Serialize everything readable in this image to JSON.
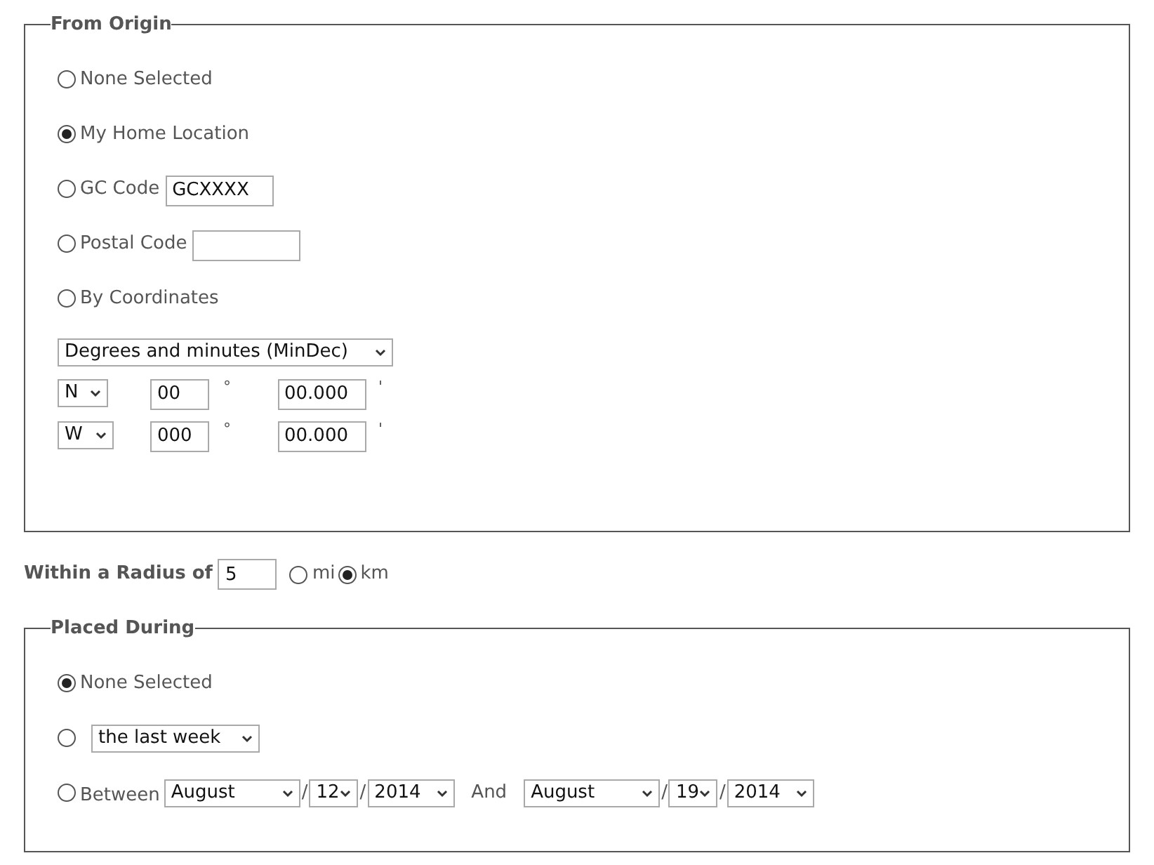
{
  "origin": {
    "legend": "From Origin",
    "options": [
      {
        "kind": "plain",
        "label": "None Selected",
        "selected": false
      },
      {
        "kind": "plain",
        "label": "My Home Location",
        "selected": true
      },
      {
        "kind": "field",
        "label": "GC Code",
        "value": "GCXXXX",
        "selected": false
      },
      {
        "kind": "field",
        "label": "Postal Code",
        "selected": false
      },
      {
        "kind": "plain",
        "label": "By Coordinates",
        "selected": false
      }
    ],
    "format": "Degrees and minutes (MinDec)",
    "coords": [
      {
        "hemisphere": "N",
        "degrees": "00",
        "degree_mark": "°",
        "minutes": "00.000",
        "minute_mark": "'"
      },
      {
        "hemisphere": "W",
        "degrees": "000",
        "degree_mark": "°",
        "minutes": "00.000",
        "minute_mark": "'"
      }
    ]
  },
  "radius": {
    "label": "Within a Radius of",
    "value": "5",
    "units": [
      {
        "label": "mi",
        "selected": false
      },
      {
        "label": "km",
        "selected": true
      }
    ]
  },
  "placed": {
    "legend": "Placed During",
    "options": [
      {
        "kind": "plain",
        "label": "None Selected",
        "selected": true
      },
      {
        "kind": "period",
        "value": "the last week",
        "selected": false
      },
      {
        "kind": "range",
        "label": "Between",
        "from": [
          "August",
          "12",
          "2014"
        ],
        "separators": [
          "/",
          "/"
        ],
        "joiner": "And",
        "to": [
          "August",
          "19",
          "2014"
        ],
        "to_separators": [
          "/",
          "/"
        ],
        "selected": false
      }
    ]
  }
}
